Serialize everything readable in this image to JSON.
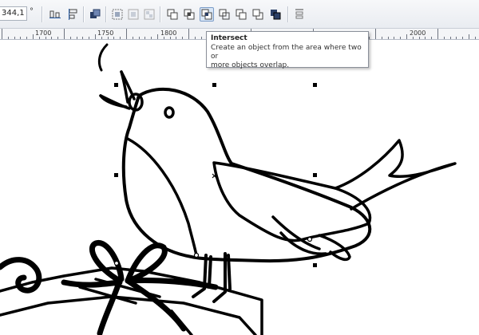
{
  "toolbar": {
    "angle_value": "344,1",
    "degree_symbol": "°",
    "buttons": [
      {
        "name": "align-horizontal-icon"
      },
      {
        "name": "align-vertical-icon"
      },
      {
        "name": "arrange-order-icon"
      },
      {
        "name": "group-icon"
      },
      {
        "name": "ungroup-icon"
      },
      {
        "name": "ungroup-all-icon"
      },
      {
        "name": "weld-icon"
      },
      {
        "name": "trim-icon"
      },
      {
        "name": "intersect-icon"
      },
      {
        "name": "simplify-icon"
      },
      {
        "name": "front-minus-back-icon"
      },
      {
        "name": "back-minus-front-icon"
      },
      {
        "name": "create-boundary-icon"
      },
      {
        "name": "align-distribute-icon"
      }
    ]
  },
  "ruler": {
    "labels": [
      "1700",
      "1750",
      "1800",
      "2000"
    ]
  },
  "tooltip": {
    "title": "Intersect",
    "description_line1": "Create an object from the area where two or",
    "description_line2": "more objects overlap."
  },
  "colors": {
    "toolbar_bg": "#e9ecf1",
    "active_button": "#d9e6f6",
    "drawing_stroke": "#000000",
    "canvas_bg": "#ffffff"
  }
}
